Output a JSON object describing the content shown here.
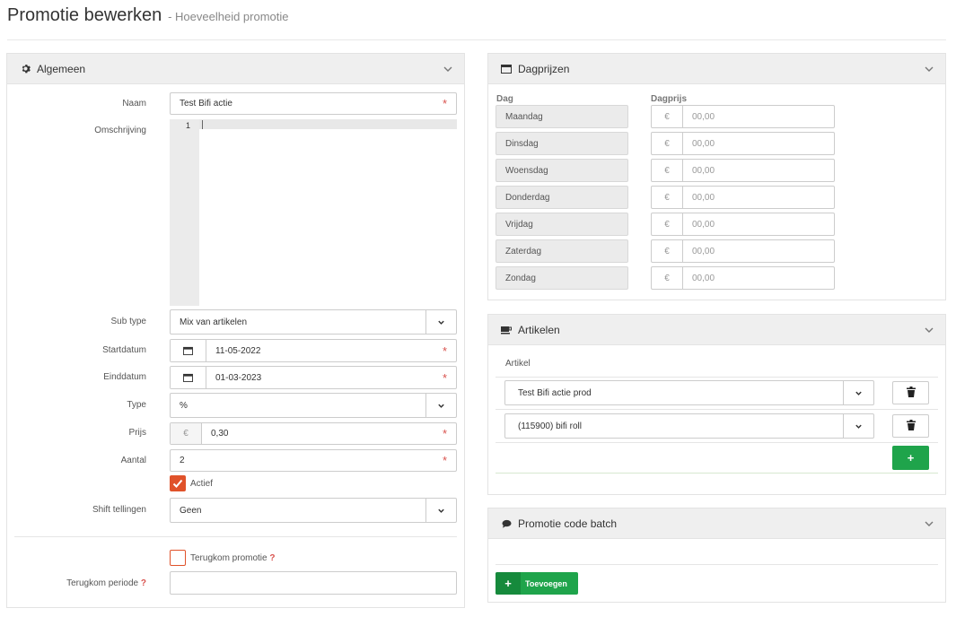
{
  "page": {
    "title": "Promotie bewerken",
    "subtitle": "- Hoeveelheid promotie"
  },
  "algemeen": {
    "title": "Algemeen",
    "labels": {
      "naam": "Naam",
      "omschrijving": "Omschrijving",
      "subtype": "Sub type",
      "startdatum": "Startdatum",
      "einddatum": "Einddatum",
      "type": "Type",
      "prijs": "Prijs",
      "aantal": "Aantal",
      "shift": "Shift tellingen",
      "terugkom_periode": "Terugkom periode"
    },
    "values": {
      "naam": "Test Bifi actie",
      "subtype": "Mix van artikelen",
      "startdatum": "11-05-2022",
      "einddatum": "01-03-2023",
      "type": "%",
      "prijs": "0,30",
      "aantal": "2",
      "shift": "Geen",
      "terugkom_periode": ""
    },
    "editor_line": "1",
    "currency": "€",
    "required_mark": "*",
    "actief_label": "Actief",
    "actief_checked": true,
    "terugkom_label": "Terugkom promotie",
    "terugkom_checked": false,
    "help_mark": "?"
  },
  "dagprijzen": {
    "title": "Dagprijzen",
    "col_day": "Dag",
    "col_price": "Dagprijs",
    "currency": "€",
    "days": [
      {
        "day": "Maandag",
        "price": "00,00"
      },
      {
        "day": "Dinsdag",
        "price": "00,00"
      },
      {
        "day": "Woensdag",
        "price": "00,00"
      },
      {
        "day": "Donderdag",
        "price": "00,00"
      },
      {
        "day": "Vrijdag",
        "price": "00,00"
      },
      {
        "day": "Zaterdag",
        "price": "00,00"
      },
      {
        "day": "Zondag",
        "price": "00,00"
      }
    ]
  },
  "artikelen": {
    "title": "Artikelen",
    "col_artikel": "Artikel",
    "items": [
      "Test Bifi actie prod",
      "(115900) bifi roll"
    ],
    "add_label": "+"
  },
  "batch": {
    "title": "Promotie code batch",
    "add_icon": "+",
    "add_label": "Toevoegen"
  },
  "colors": {
    "accent_orange": "#e0522a",
    "green": "#1fa44b",
    "required": "#d9534f"
  }
}
